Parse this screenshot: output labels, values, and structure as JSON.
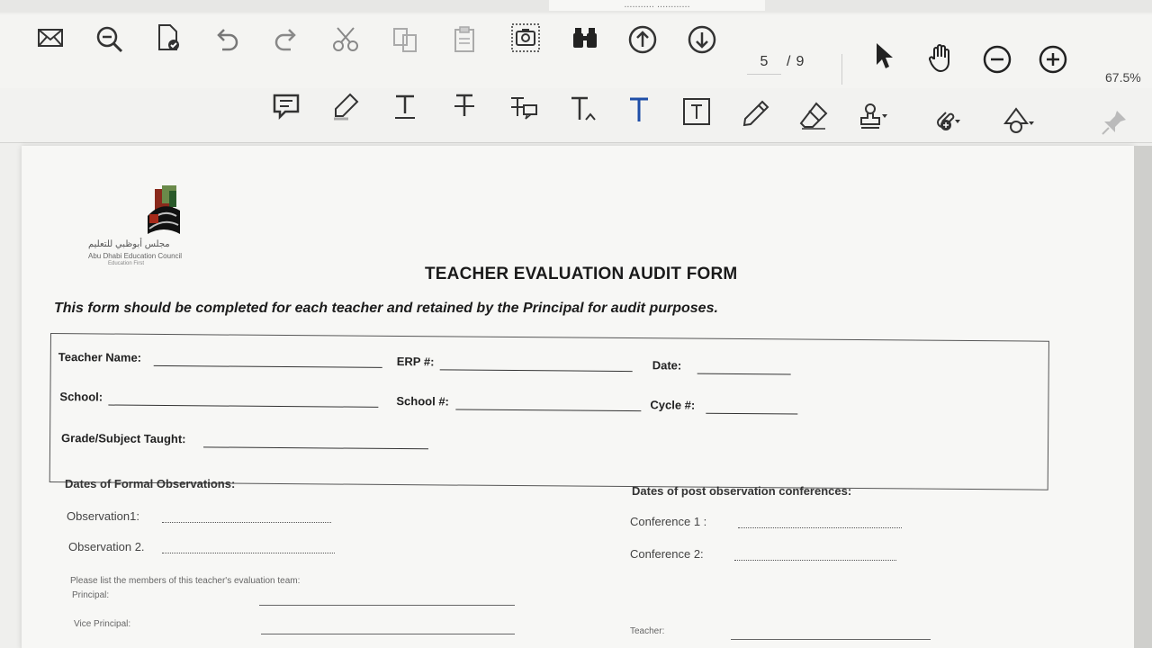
{
  "window": {
    "title_fragment": "........... ............"
  },
  "toolbar": {
    "page_current": "5",
    "page_separator": "/",
    "page_total": "9",
    "zoom": "67.5%"
  },
  "document": {
    "logo": {
      "arabic_name": "مجلس أبوظبي للتعليم",
      "english_name": "Abu Dhabi Education Council",
      "sub_text": "Education First"
    },
    "title": "TEACHER EVALUATION AUDIT FORM",
    "intro": "This form should be completed for each teacher and retained by the Principal for audit purposes.",
    "fields": {
      "teacher_name": "Teacher Name:",
      "erp": "ERP #:",
      "date": "Date:",
      "school": "School:",
      "school_no": "School #:",
      "cycle": "Cycle #:",
      "grade_subject": "Grade/Subject Taught:"
    },
    "formal_observations": {
      "heading": "Dates of Formal Observations:",
      "obs1": "Observation1:",
      "obs2": "Observation 2."
    },
    "post_conferences": {
      "heading": "Dates of post observation conferences:",
      "conf1": "Conference 1 :",
      "conf2": "Conference 2:"
    },
    "team": {
      "note": "Please list the members of this teacher's evaluation team:",
      "principal": "Principal:",
      "vice_principal": "Vice Principal:",
      "teacher": "Teacher:"
    }
  }
}
